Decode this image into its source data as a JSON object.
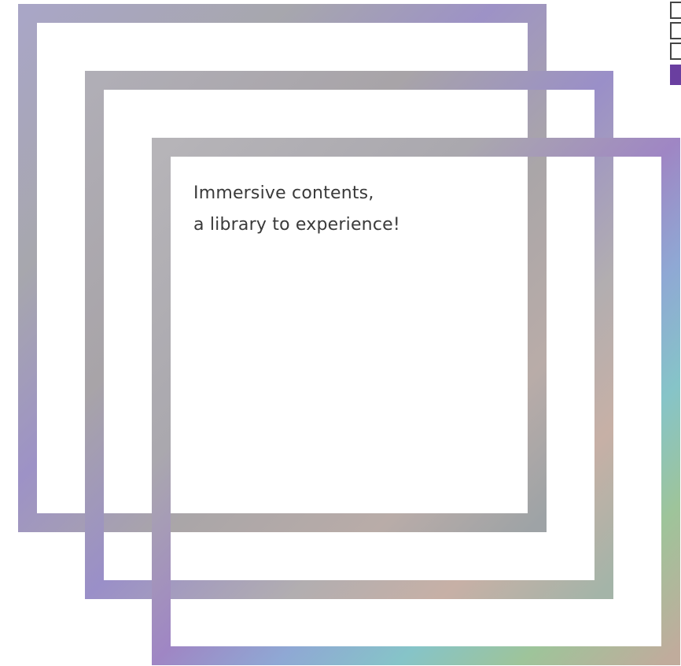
{
  "headline": {
    "line1": "Immersive contents,",
    "line2": "a library to experience!"
  },
  "colors": {
    "background": "#ffffff",
    "text": "#3a3a3a",
    "frame_gradient": [
      "#a8a8b0",
      "#9c96c8",
      "#8e80c0",
      "#a0a0a8",
      "#c8b0a8",
      "#9cc0a0",
      "#88c0c8",
      "#b0a8a0"
    ],
    "corner_accent": "#6a3fa0"
  },
  "icons": [
    "logo-mark"
  ]
}
